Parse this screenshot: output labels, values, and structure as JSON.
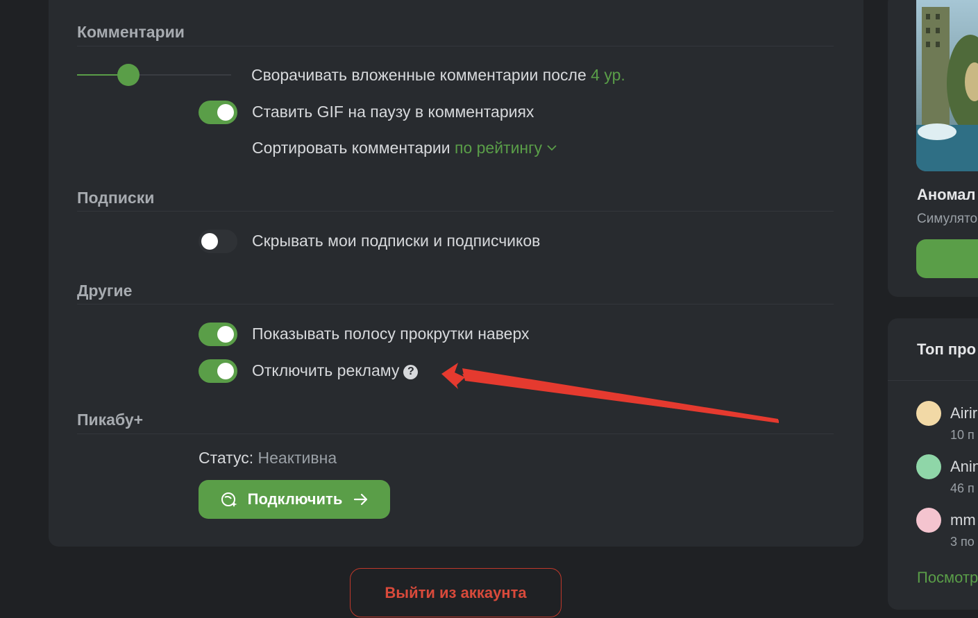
{
  "sections": {
    "comments": {
      "title": "Комментарии",
      "collapse_prefix": "Сворачивать вложенные комментарии после",
      "collapse_value": "4 ур.",
      "collapse_level": 4,
      "gif_pause_label": "Ставить GIF на паузу в комментариях",
      "gif_pause_on": true,
      "sort_prefix": "Сортировать комментарии",
      "sort_value": "по рейтингу"
    },
    "subscriptions": {
      "title": "Подписки",
      "hide_label": "Скрывать мои подписки и подписчиков",
      "hide_on": false
    },
    "other": {
      "title": "Другие",
      "scrollbar_label": "Показывать полосу прокрутки наверх",
      "scrollbar_on": true,
      "disable_ads_label": "Отключить рекламу",
      "disable_ads_on": true,
      "help_glyph": "?"
    },
    "pikabu_plus": {
      "title": "Пикабу+",
      "status_label": "Статус:",
      "status_value": "Неактивна",
      "connect_label": "Подключить"
    }
  },
  "logout_label": "Выйти из аккаунта",
  "sidebar": {
    "promo_title": "Аномал",
    "promo_subtitle": "Симулято",
    "top_title": "Топ про",
    "top_items": [
      {
        "name": "Airir",
        "meta": "10 п",
        "avatar_color": "#f2d9a6"
      },
      {
        "name": "Anin",
        "meta": "46 п",
        "avatar_color": "#8fd6a8"
      },
      {
        "name": "mm",
        "meta": "3 по",
        "avatar_color": "#f4c4cf"
      }
    ],
    "view_all": "Посмотр"
  },
  "colors": {
    "accent": "#5a9e48",
    "danger": "#d94a3b",
    "annotation_arrow": "#e53a2f"
  },
  "icons": {
    "connect": "pikabu-plus-icon",
    "arrow": "arrow-right-icon",
    "sort_chevron": "chevron-down-icon",
    "help": "help-circle-icon"
  }
}
